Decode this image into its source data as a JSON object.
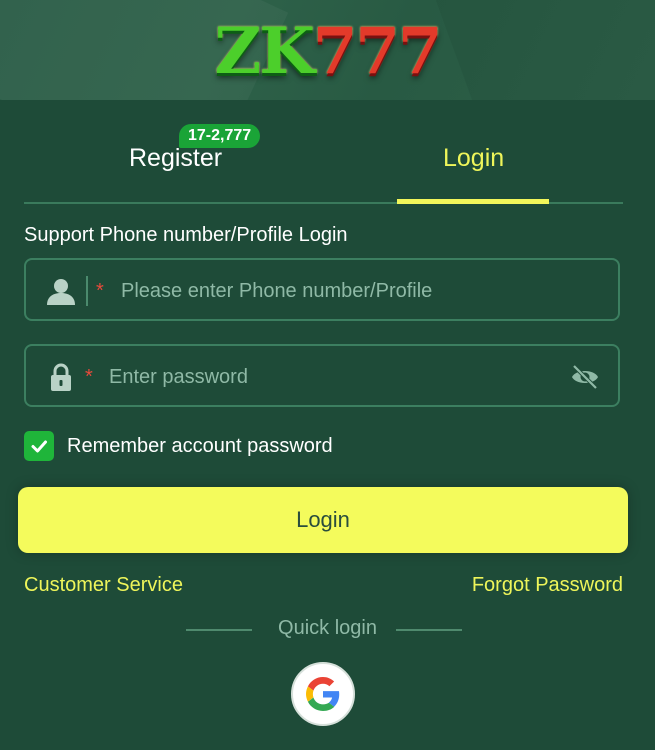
{
  "brand": {
    "logo_zk": "ZK",
    "logo_num": "777"
  },
  "tabs": {
    "register_label": "Register",
    "register_badge": "17-2,777",
    "login_label": "Login",
    "active": "login"
  },
  "form": {
    "section_label": "Support Phone number/Profile Login",
    "phone_required_mark": "*",
    "phone_placeholder": "Please enter Phone number/Profile",
    "password_required_mark": "*",
    "password_placeholder": "Enter password",
    "remember_label": "Remember account password",
    "remember_checked": true,
    "login_button": "Login"
  },
  "links": {
    "customer_service": "Customer Service",
    "forgot_password": "Forgot Password"
  },
  "quick_login": {
    "label": "Quick login",
    "providers": [
      "google-icon"
    ]
  },
  "colors": {
    "accent": "#f4fb5c",
    "background": "#1e4b38",
    "badge": "#1aa437",
    "checkbox": "#1fb53a"
  }
}
